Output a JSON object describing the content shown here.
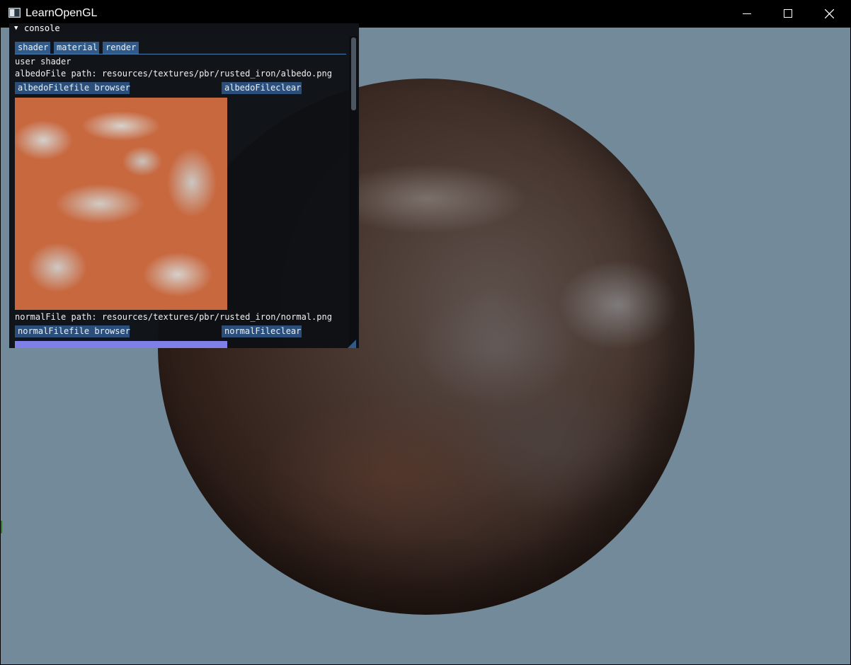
{
  "window": {
    "title": "LearnOpenGL",
    "icons": {
      "app": "app-window-icon",
      "minimize": "minimize-icon",
      "maximize": "maximize-icon",
      "close": "close-icon"
    }
  },
  "viewport": {
    "background_color": "#728a99",
    "object": "rusted-iron-sphere"
  },
  "console": {
    "title": "console",
    "collapse_icon": "collapse-arrow-icon",
    "collapse_glyph": "▼",
    "tabs": [
      {
        "label": "shader"
      },
      {
        "label": "material"
      },
      {
        "label": "render"
      }
    ],
    "user_shader_label": "user shader",
    "albedo": {
      "path_text": "albedoFile path: resources/textures/pbr/rusted_iron/albedo.png",
      "browse_label": "albedoFilefile browser",
      "clear_label": "albedoFileclear"
    },
    "normal": {
      "path_text": "normalFile path: resources/textures/pbr/rusted_iron/normal.png",
      "browse_label": "normalFilefile browser",
      "clear_label": "normalFileclear"
    },
    "accent_color": "#2f5a8a"
  }
}
